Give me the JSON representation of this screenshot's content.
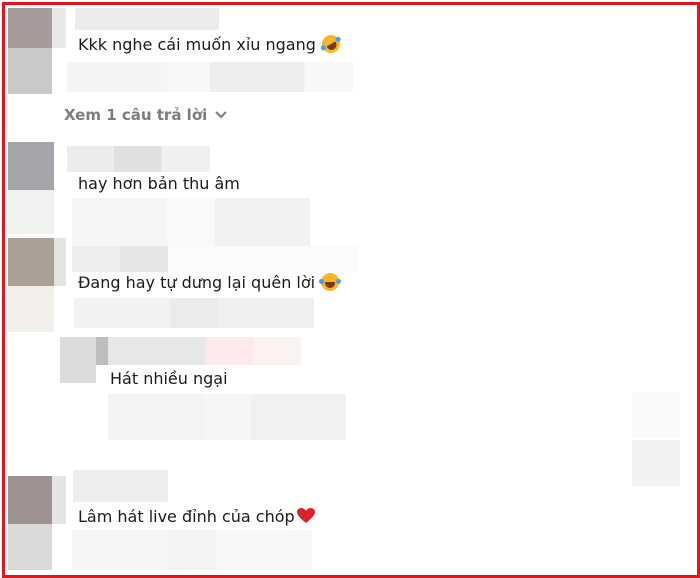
{
  "comments": [
    {
      "text": "Kkk nghe cái muốn xỉu ngang",
      "emoji": "rolling-on-floor-laughing"
    },
    {
      "text": "hay hơn bản thu âm"
    },
    {
      "text": "Đang hay tự dưng lại quên lời",
      "emoji": "face-with-tears-of-joy"
    },
    {
      "text": "Hát nhiều ngại"
    },
    {
      "text": "Lâm hát live đỉnh của chóp",
      "emoji": "red-heart"
    }
  ],
  "view_replies": {
    "label": "Xem 1 câu trả lời",
    "icon": "chevron-down-icon"
  },
  "colors": {
    "frame": "#e8141b",
    "heart": "#e0202a",
    "muted": "#7c7c7c"
  }
}
